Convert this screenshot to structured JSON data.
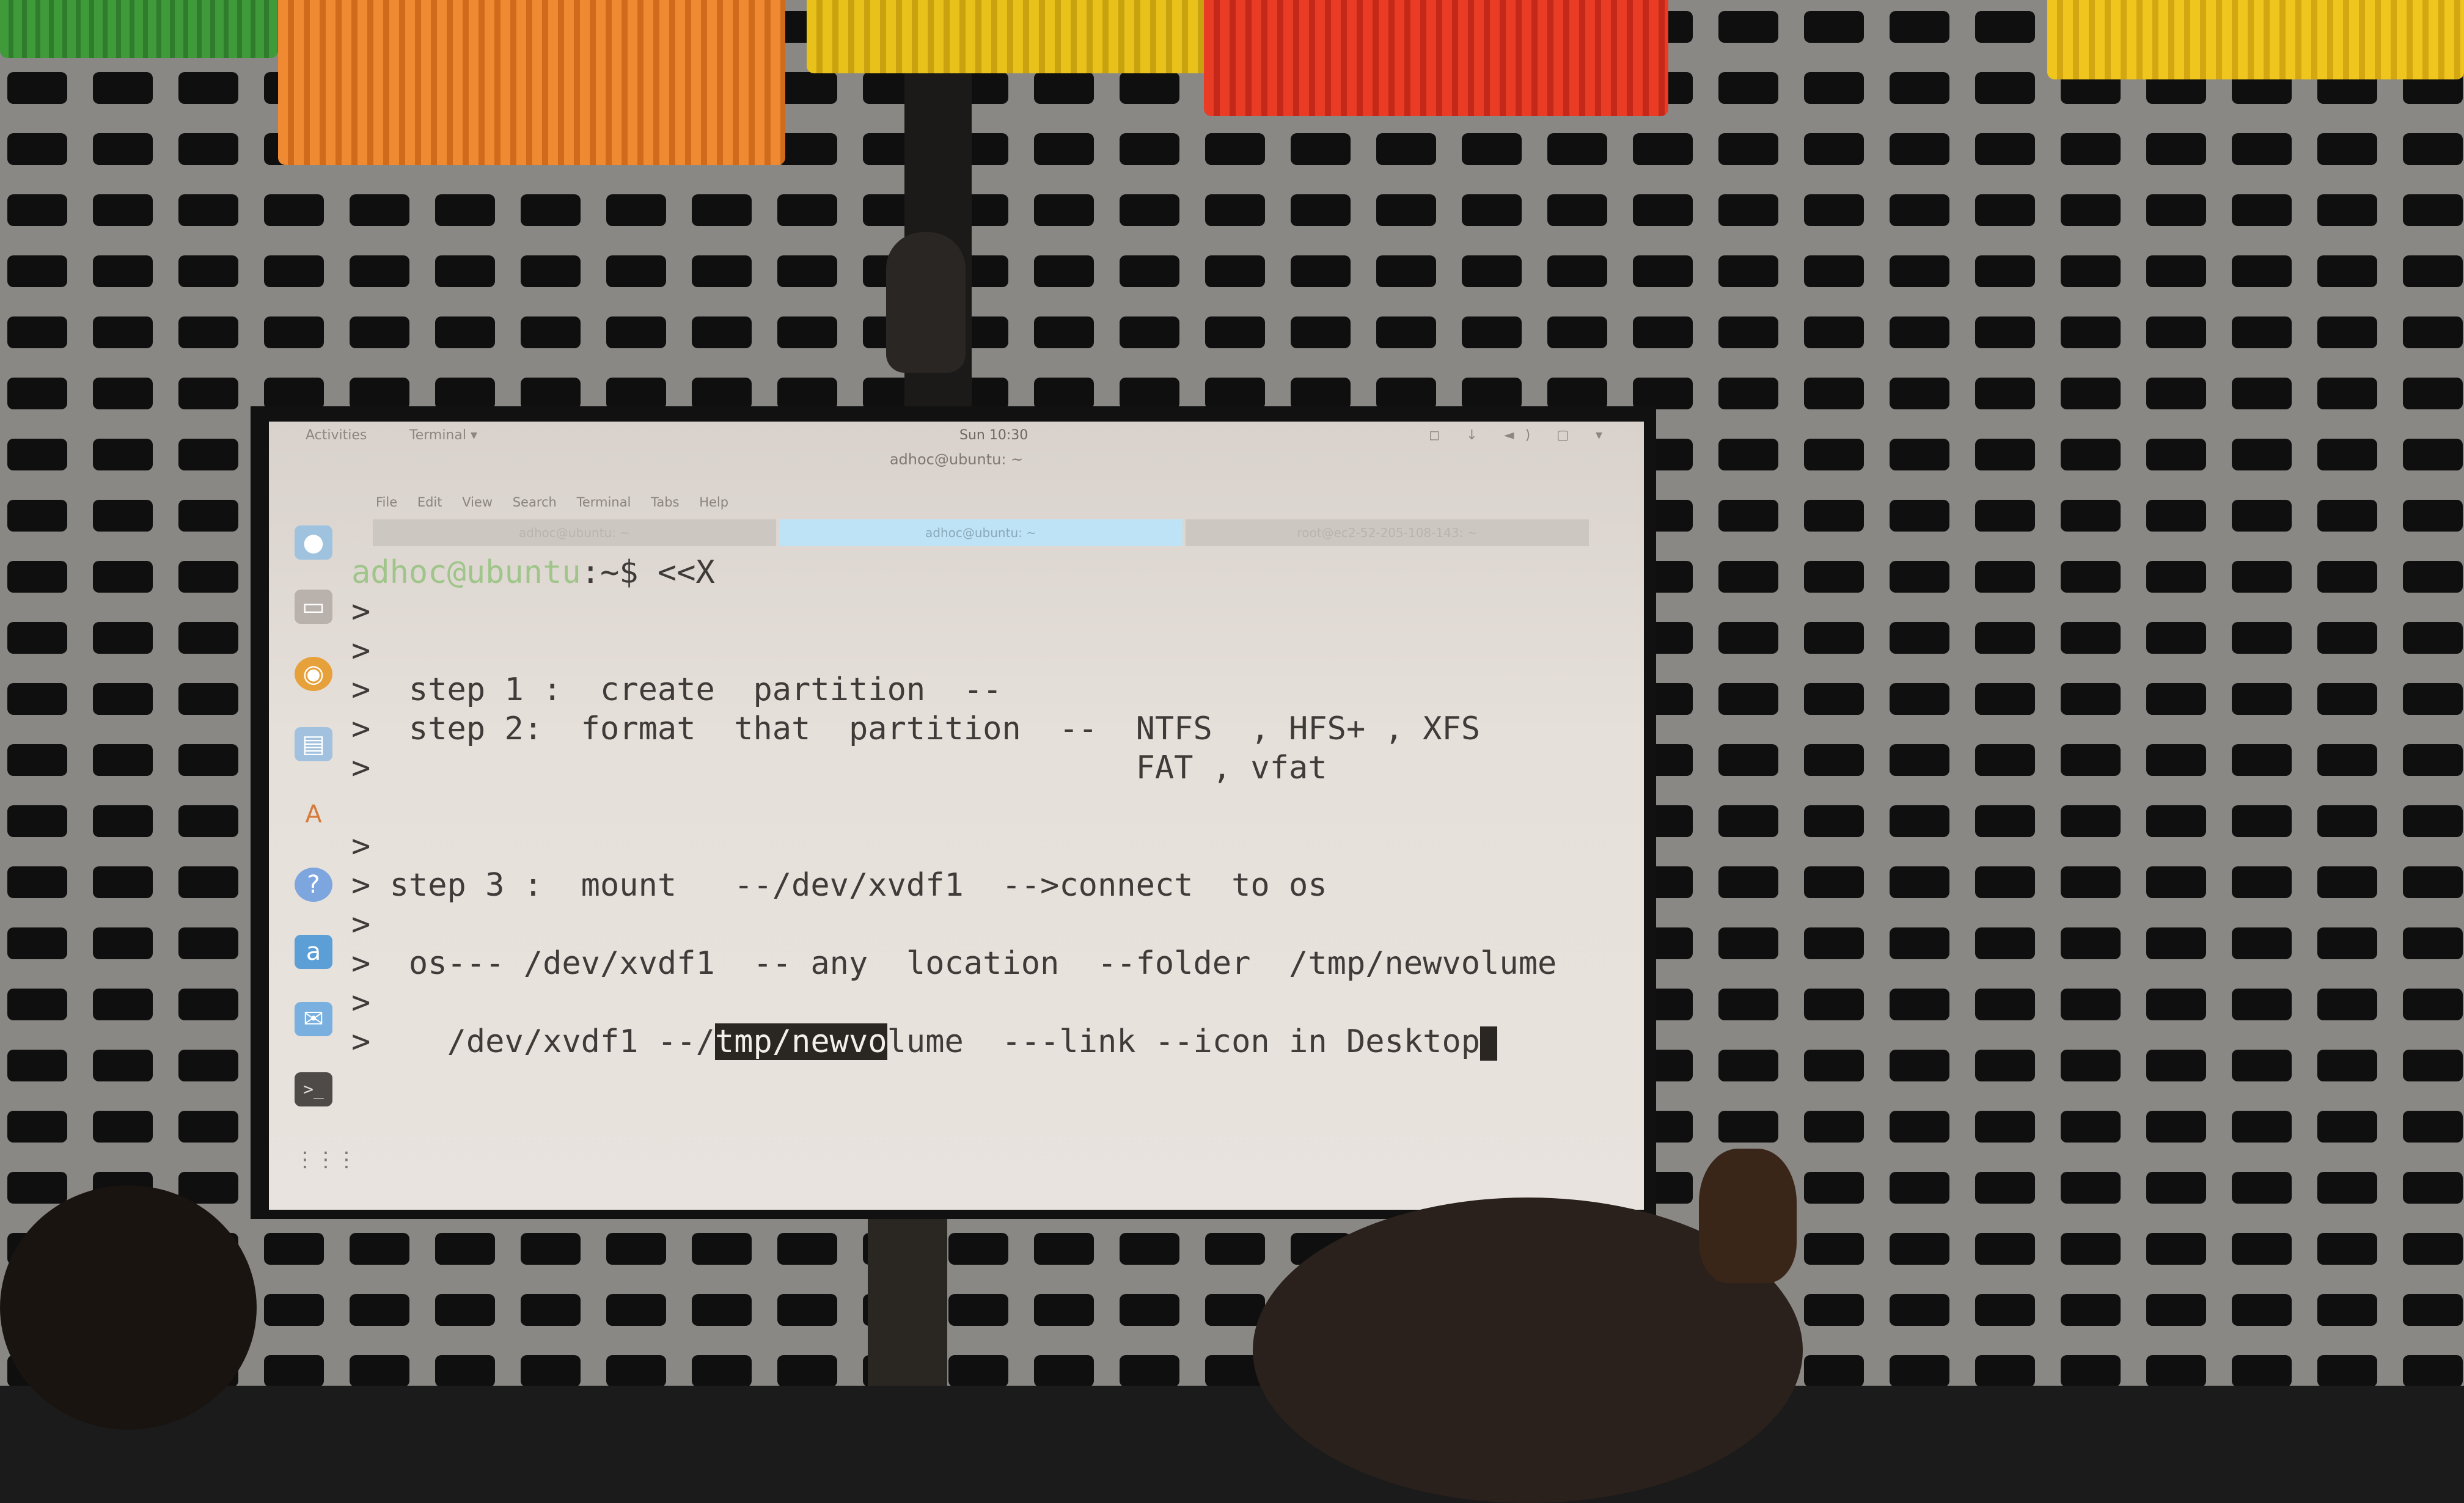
{
  "screen": {
    "topbar": {
      "activities": "Activities",
      "app": "Terminal ▾",
      "clock": "Sun 10:30",
      "tray": "◻ ↓ ◄) ▢ ▾"
    },
    "window_title": "adhoc@ubuntu: ~",
    "menu": [
      "File",
      "Edit",
      "View",
      "Search",
      "Terminal",
      "Tabs",
      "Help"
    ],
    "tabs": [
      "adhoc@ubuntu: ~",
      "adhoc@ubuntu: ~",
      "root@ec2-52-205-108-143: ~"
    ],
    "launcher_icons": [
      "chromium-icon",
      "files-icon",
      "firefox-icon",
      "document-icon",
      "software-icon",
      "help-icon",
      "amazon-icon",
      "email-icon",
      "terminal-icon",
      "apps-grid-icon"
    ],
    "terminal": {
      "prompt_user": "adhoc@ubuntu",
      "prompt_path": ":~$ <<X",
      "lines": [
        ">",
        ">",
        ">  step 1 :  create  partition  --",
        ">  step 2:  format  that  partition  --  NTFS  , HFS+ , XFS",
        ">                                        FAT , vfat",
        ">",
        "> step 3 :  mount   --/dev/xvdf1  -->connect  to os",
        ">",
        ">  os--- /dev/xvdf1  -- any  location  --folder  /tmp/newvolume",
        ">"
      ],
      "last_line_pre": ">    /dev/xvdf1 --/",
      "last_line_highlight": "tmp/newvo",
      "last_line_post": "lume  ---link --icon in Desktop"
    }
  }
}
